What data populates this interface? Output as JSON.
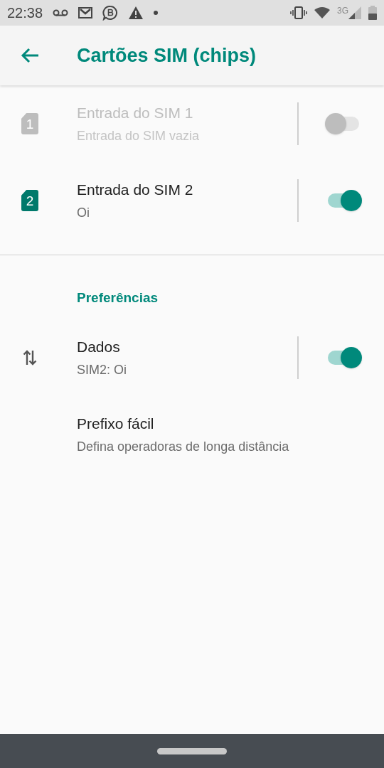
{
  "status_bar": {
    "time": "22:38",
    "network": "3G"
  },
  "app_bar": {
    "title": "Cartões SIM (chips)"
  },
  "sim_slots": [
    {
      "number": "1",
      "title": "Entrada do SIM 1",
      "subtitle": "Entrada do SIM vazia",
      "disabled": true,
      "on": false
    },
    {
      "number": "2",
      "title": "Entrada do SIM 2",
      "subtitle": "Oi",
      "disabled": false,
      "on": true
    }
  ],
  "section_header": "Preferências",
  "preferences": [
    {
      "kind": "switch",
      "title": "Dados",
      "subtitle": "SIM2: Oi",
      "on": true
    },
    {
      "kind": "plain",
      "title": "Prefixo fácil",
      "subtitle": "Defina operadoras de longa distância"
    }
  ]
}
